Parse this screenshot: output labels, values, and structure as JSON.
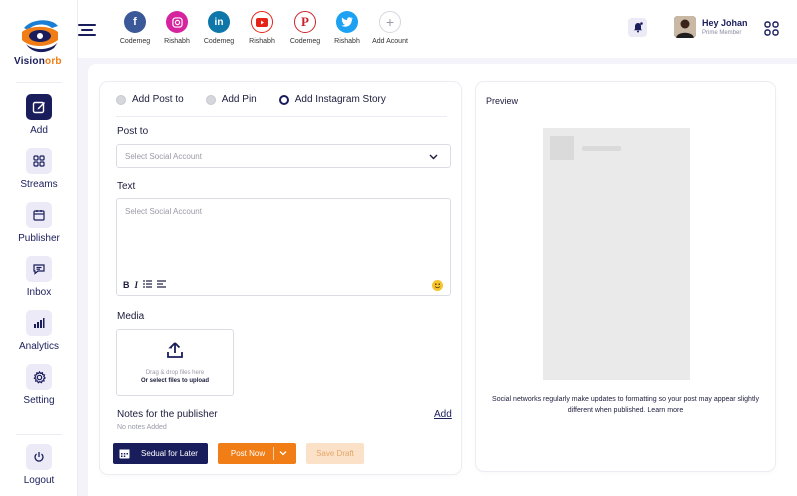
{
  "brand": {
    "name_part1": "Vision",
    "name_part2": "orb"
  },
  "sidebar": {
    "items": [
      {
        "label": "Add",
        "icon": "compose-icon",
        "active": true
      },
      {
        "label": "Streams",
        "icon": "grid-icon"
      },
      {
        "label": "Publisher",
        "icon": "calendar-icon"
      },
      {
        "label": "Inbox",
        "icon": "chat-icon"
      },
      {
        "label": "Analytics",
        "icon": "bar-chart-icon"
      },
      {
        "label": "Setting",
        "icon": "gear-icon"
      }
    ],
    "logout_label": "Logout"
  },
  "topbar": {
    "accounts": [
      {
        "label": "Codemeg",
        "network": "facebook",
        "color": "#3b5998"
      },
      {
        "label": "Rishabh",
        "network": "instagram",
        "color": "#d6249f"
      },
      {
        "label": "Codemeg",
        "network": "linkedin",
        "color": "#0e76a8"
      },
      {
        "label": "Rishabh",
        "network": "youtube",
        "color": "#e62117"
      },
      {
        "label": "Codemeg",
        "network": "pinterest",
        "color": "#c8232c"
      },
      {
        "label": "Rishabh",
        "network": "twitter",
        "color": "#1da1f2"
      },
      {
        "label": "Add Acount",
        "network": "add"
      }
    ],
    "user": {
      "greeting": "Hey Johan",
      "role": "Prime Member"
    }
  },
  "composer": {
    "post_types": [
      "Add Post to",
      "Add Pin",
      "Add Instagram Story"
    ],
    "selected_post_type": "Add Instagram Story",
    "post_to": {
      "label": "Post to",
      "placeholder": "Select Social Account"
    },
    "text": {
      "label": "Text",
      "placeholder": "Select Social Account",
      "format_buttons": [
        "B",
        "I",
        "list",
        "list-ordered"
      ]
    },
    "media": {
      "label": "Media",
      "drop_hint": "Drag & drop files here",
      "select_hint": "Or select files to upload"
    },
    "notes": {
      "label": "Notes for the publisher",
      "add_label": "Add",
      "empty": "No notes Added"
    },
    "buttons": {
      "schedule": "Sedual for Later",
      "post_now": "Post Now",
      "draft": "Save Draft"
    }
  },
  "preview": {
    "title": "Preview",
    "note": "Social networks regularly make updates to formatting so your post may appear slightly different when published. Learn more"
  },
  "colors": {
    "primary": "#1a1d5c",
    "accent": "#f07d16"
  }
}
